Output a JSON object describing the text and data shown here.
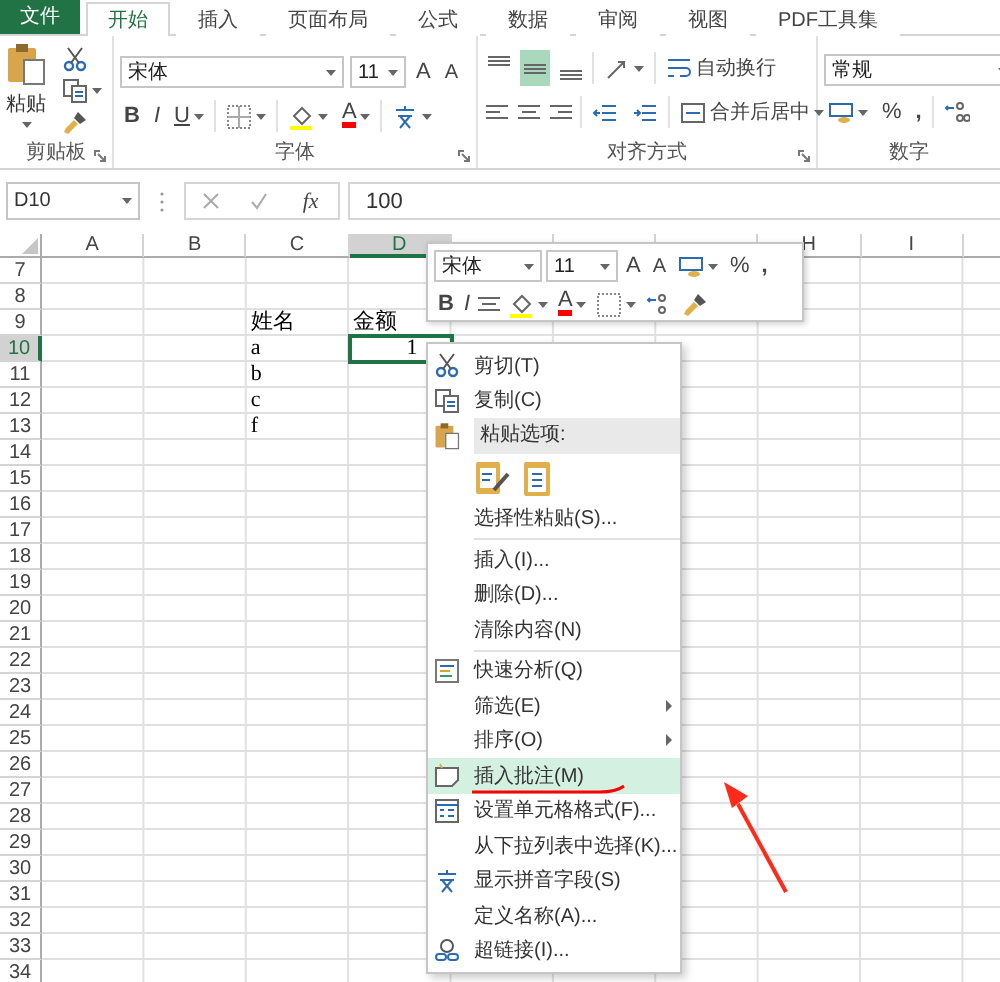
{
  "file_tab": "文件",
  "tabs": [
    {
      "label": "开始",
      "selected": true
    },
    {
      "label": "插入",
      "selected": false
    },
    {
      "label": "页面布局",
      "selected": false
    },
    {
      "label": "公式",
      "selected": false
    },
    {
      "label": "数据",
      "selected": false
    },
    {
      "label": "审阅",
      "selected": false
    },
    {
      "label": "视图",
      "selected": false
    },
    {
      "label": "PDF工具集",
      "selected": false
    }
  ],
  "ribbon": {
    "clipboard": {
      "paste": "粘贴",
      "label": "剪贴板"
    },
    "font": {
      "name": "宋体",
      "size": "11",
      "grow": "A",
      "shrink": "A",
      "bold": "B",
      "italic": "I",
      "underline": "U",
      "color_letter": "A",
      "label": "字体"
    },
    "alignment": {
      "vertical": [
        {
          "selected": false
        },
        {
          "selected": true
        },
        {
          "selected": false
        }
      ],
      "wrap_text": "自动换行",
      "merge_center": "合并后居中",
      "label": "对齐方式"
    },
    "number": {
      "format": "常规",
      "percent": "%",
      "comma": ",",
      "label": "数字"
    }
  },
  "formula_bar": {
    "name_box": "D10",
    "function_label": "fx",
    "value": "100"
  },
  "sheet": {
    "columns": [
      {
        "label": "A",
        "selected": false
      },
      {
        "label": "B",
        "selected": false
      },
      {
        "label": "C",
        "selected": false
      },
      {
        "label": "D",
        "selected": true
      },
      {
        "selected": false
      },
      {
        "selected": false
      },
      {
        "selected": false
      },
      {
        "label": "H",
        "selected": false
      },
      {
        "label": "I",
        "selected": false
      }
    ],
    "rows": [
      {
        "label": "7",
        "selected": false
      },
      {
        "label": "8",
        "selected": false
      },
      {
        "label": "9",
        "selected": false,
        "column_C": "姓名",
        "column_D": "金额"
      },
      {
        "label": "10",
        "selected": true,
        "column_C": "a",
        "column_D": "1"
      },
      {
        "label": "11",
        "selected": false,
        "column_C": "b"
      },
      {
        "label": "12",
        "selected": false,
        "column_C": "c"
      },
      {
        "label": "13",
        "selected": false,
        "column_C": "f"
      },
      {
        "label": "14",
        "selected": false
      },
      {
        "label": "15",
        "selected": false
      },
      {
        "label": "16",
        "selected": false
      },
      {
        "label": "17",
        "selected": false
      },
      {
        "label": "18",
        "selected": false
      },
      {
        "label": "19",
        "selected": false
      },
      {
        "label": "20",
        "selected": false
      },
      {
        "label": "21",
        "selected": false
      },
      {
        "label": "22",
        "selected": false
      },
      {
        "label": "23",
        "selected": false
      },
      {
        "label": "24",
        "selected": false
      },
      {
        "label": "25",
        "selected": false
      },
      {
        "label": "26",
        "selected": false
      },
      {
        "label": "27",
        "selected": false
      },
      {
        "label": "28",
        "selected": false
      },
      {
        "label": "29",
        "selected": false
      },
      {
        "label": "30",
        "selected": false
      },
      {
        "label": "31",
        "selected": false
      },
      {
        "label": "32",
        "selected": false
      },
      {
        "label": "33",
        "selected": false
      },
      {
        "label": "34",
        "selected": false
      }
    ]
  },
  "mini_toolbar": {
    "font": "宋体",
    "size": "11",
    "grow": "A",
    "shrink": "A",
    "percent": "%",
    "comma": ",",
    "bold": "B",
    "italic": "I",
    "color_letter": "A"
  },
  "context_menu": [
    {
      "kind": "command",
      "label": "剪切(T)",
      "selected": false,
      "submenu": false
    },
    {
      "kind": "command",
      "label": "复制(C)",
      "selected": false,
      "submenu": false
    },
    {
      "kind": "header",
      "label": "粘贴选项:"
    },
    {
      "kind": "paste_icons"
    },
    {
      "kind": "command",
      "label": "选择性粘贴(S)...",
      "selected": false,
      "submenu": false
    },
    {
      "kind": "separator"
    },
    {
      "kind": "command",
      "label": "插入(I)...",
      "selected": false,
      "submenu": false
    },
    {
      "kind": "command",
      "label": "删除(D)...",
      "selected": false,
      "submenu": false
    },
    {
      "kind": "command",
      "label": "清除内容(N)",
      "selected": false,
      "submenu": false
    },
    {
      "kind": "separator"
    },
    {
      "kind": "command",
      "label": "快速分析(Q)",
      "selected": false,
      "submenu": false
    },
    {
      "kind": "command",
      "label": "筛选(E)",
      "selected": false,
      "submenu": true
    },
    {
      "kind": "command",
      "label": "排序(O)",
      "selected": false,
      "submenu": true
    },
    {
      "kind": "command",
      "label": "插入批注(M)",
      "selected": true,
      "submenu": false
    },
    {
      "kind": "command",
      "label": "设置单元格格式(F)...",
      "selected": false,
      "submenu": false
    },
    {
      "kind": "command",
      "label": "从下拉列表中选择(K)...",
      "selected": false,
      "submenu": false
    },
    {
      "kind": "command",
      "label": "显示拼音字段(S)",
      "selected": false,
      "submenu": false
    },
    {
      "kind": "command",
      "label": "定义名称(A)...",
      "selected": false,
      "submenu": false
    },
    {
      "kind": "command",
      "label": "超链接(I)...",
      "selected": false,
      "submenu": false
    }
  ]
}
